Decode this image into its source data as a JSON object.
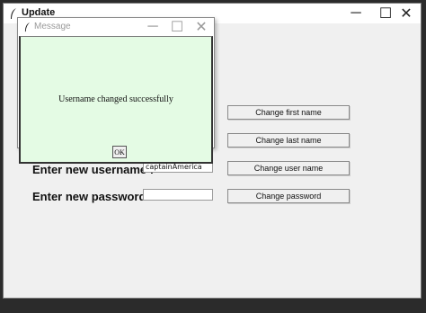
{
  "window": {
    "title": "Update",
    "minimize": "─",
    "maximize": "☐",
    "close": "✕"
  },
  "form": {
    "username_label": "Enter new username :",
    "username_value": "captainAmerica",
    "password_label": "Enter new password :",
    "password_value": ""
  },
  "buttons": {
    "change_first_name": "Change first name",
    "change_last_name": "Change last name",
    "change_user_name": "Change user name",
    "change_password": "Change password"
  },
  "dialog": {
    "title": "Message",
    "minimize": "─",
    "maximize": "☐",
    "close": "✕",
    "message": "Username changed successfully",
    "ok_label": "OK",
    "body_color": "#e4fbe4"
  },
  "icons": {
    "app": "feather-icon",
    "dialog": "feather-icon"
  }
}
